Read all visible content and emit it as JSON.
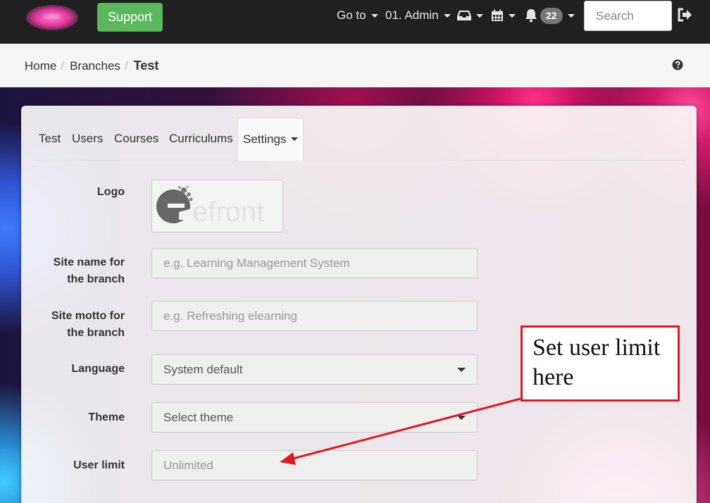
{
  "navbar": {
    "logo_text": "LOGO",
    "support_label": "Support",
    "goto_label": "Go to",
    "user_label": "01. Admin",
    "notifications_count": "22",
    "search_placeholder": "Search",
    "icons": [
      "inbox-icon",
      "calendar-icon",
      "bell-icon",
      "logout-icon"
    ]
  },
  "breadcrumb": {
    "items": [
      "Home",
      "Branches"
    ],
    "current": "Test"
  },
  "tabs": [
    {
      "label": "Test"
    },
    {
      "label": "Users"
    },
    {
      "label": "Courses"
    },
    {
      "label": "Curriculums"
    },
    {
      "label": "Settings",
      "active": true
    }
  ],
  "form": {
    "logo_label": "Logo",
    "logo_wordmark": "efront",
    "site_name_label_1": "Site name for",
    "site_name_label_2": "the branch",
    "site_name_placeholder": "e.g. Learning Management System",
    "site_motto_label_1": "Site motto for",
    "site_motto_label_2": "the branch",
    "site_motto_placeholder": "e.g. Refreshing elearning",
    "language_label": "Language",
    "language_value": "System default",
    "theme_label": "Theme",
    "theme_value": "Select theme",
    "user_limit_label": "User limit",
    "user_limit_placeholder": "Unlimited"
  },
  "annotation": {
    "text_line1": "Set user limit",
    "text_line2": "here",
    "color": "#e0191e"
  },
  "colors": {
    "navbar_bg": "#202020",
    "support_green": "#5cb85c",
    "badge_grey": "#777777"
  }
}
